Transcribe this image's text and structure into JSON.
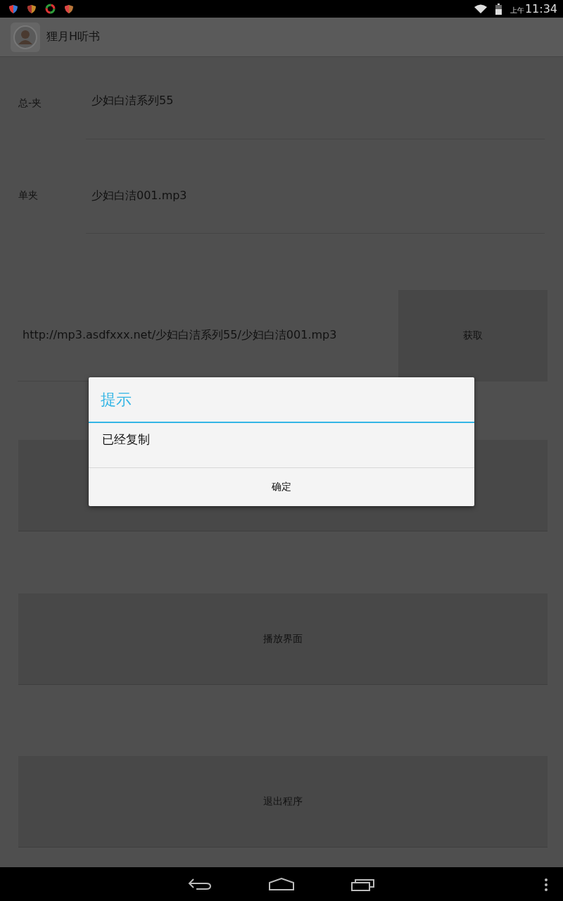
{
  "status_bar": {
    "am_pm": "上午",
    "time": "11:34"
  },
  "action_bar": {
    "title": "狸月H听书"
  },
  "fields": [
    {
      "label": "总-夹",
      "value": "少妇白洁系列55"
    },
    {
      "label": "单夹",
      "value": "少妇白洁001.mp3"
    }
  ],
  "url_row": {
    "value": "http://mp3.asdfxxx.net/少妇白洁系列55/少妇白洁001.mp3",
    "button": "获取"
  },
  "buttons": [
    {
      "kind": "blank"
    },
    {
      "kind": "labeled",
      "label": "播放界面"
    },
    {
      "kind": "labeled",
      "label": "退出程序"
    }
  ],
  "dialog": {
    "title": "提示",
    "message": "已经复制",
    "button": "确定"
  }
}
